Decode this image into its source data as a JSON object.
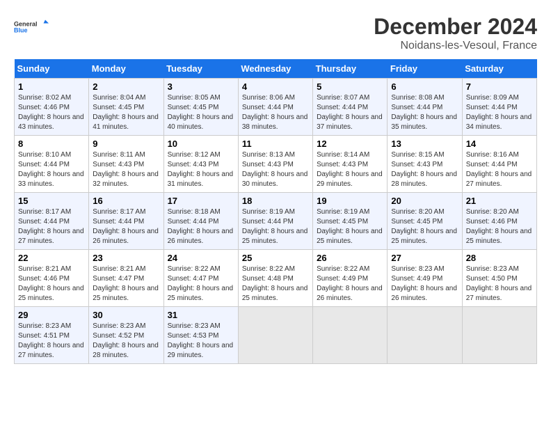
{
  "logo": {
    "text1": "General",
    "text2": "Blue"
  },
  "title": "December 2024",
  "subtitle": "Noidans-les-Vesoul, France",
  "days_header": [
    "Sunday",
    "Monday",
    "Tuesday",
    "Wednesday",
    "Thursday",
    "Friday",
    "Saturday"
  ],
  "weeks": [
    [
      {
        "day": "1",
        "sunrise": "Sunrise: 8:02 AM",
        "sunset": "Sunset: 4:46 PM",
        "daylight": "Daylight: 8 hours and 43 minutes."
      },
      {
        "day": "2",
        "sunrise": "Sunrise: 8:04 AM",
        "sunset": "Sunset: 4:45 PM",
        "daylight": "Daylight: 8 hours and 41 minutes."
      },
      {
        "day": "3",
        "sunrise": "Sunrise: 8:05 AM",
        "sunset": "Sunset: 4:45 PM",
        "daylight": "Daylight: 8 hours and 40 minutes."
      },
      {
        "day": "4",
        "sunrise": "Sunrise: 8:06 AM",
        "sunset": "Sunset: 4:44 PM",
        "daylight": "Daylight: 8 hours and 38 minutes."
      },
      {
        "day": "5",
        "sunrise": "Sunrise: 8:07 AM",
        "sunset": "Sunset: 4:44 PM",
        "daylight": "Daylight: 8 hours and 37 minutes."
      },
      {
        "day": "6",
        "sunrise": "Sunrise: 8:08 AM",
        "sunset": "Sunset: 4:44 PM",
        "daylight": "Daylight: 8 hours and 35 minutes."
      },
      {
        "day": "7",
        "sunrise": "Sunrise: 8:09 AM",
        "sunset": "Sunset: 4:44 PM",
        "daylight": "Daylight: 8 hours and 34 minutes."
      }
    ],
    [
      {
        "day": "8",
        "sunrise": "Sunrise: 8:10 AM",
        "sunset": "Sunset: 4:44 PM",
        "daylight": "Daylight: 8 hours and 33 minutes."
      },
      {
        "day": "9",
        "sunrise": "Sunrise: 8:11 AM",
        "sunset": "Sunset: 4:43 PM",
        "daylight": "Daylight: 8 hours and 32 minutes."
      },
      {
        "day": "10",
        "sunrise": "Sunrise: 8:12 AM",
        "sunset": "Sunset: 4:43 PM",
        "daylight": "Daylight: 8 hours and 31 minutes."
      },
      {
        "day": "11",
        "sunrise": "Sunrise: 8:13 AM",
        "sunset": "Sunset: 4:43 PM",
        "daylight": "Daylight: 8 hours and 30 minutes."
      },
      {
        "day": "12",
        "sunrise": "Sunrise: 8:14 AM",
        "sunset": "Sunset: 4:43 PM",
        "daylight": "Daylight: 8 hours and 29 minutes."
      },
      {
        "day": "13",
        "sunrise": "Sunrise: 8:15 AM",
        "sunset": "Sunset: 4:43 PM",
        "daylight": "Daylight: 8 hours and 28 minutes."
      },
      {
        "day": "14",
        "sunrise": "Sunrise: 8:16 AM",
        "sunset": "Sunset: 4:44 PM",
        "daylight": "Daylight: 8 hours and 27 minutes."
      }
    ],
    [
      {
        "day": "15",
        "sunrise": "Sunrise: 8:17 AM",
        "sunset": "Sunset: 4:44 PM",
        "daylight": "Daylight: 8 hours and 27 minutes."
      },
      {
        "day": "16",
        "sunrise": "Sunrise: 8:17 AM",
        "sunset": "Sunset: 4:44 PM",
        "daylight": "Daylight: 8 hours and 26 minutes."
      },
      {
        "day": "17",
        "sunrise": "Sunrise: 8:18 AM",
        "sunset": "Sunset: 4:44 PM",
        "daylight": "Daylight: 8 hours and 26 minutes."
      },
      {
        "day": "18",
        "sunrise": "Sunrise: 8:19 AM",
        "sunset": "Sunset: 4:44 PM",
        "daylight": "Daylight: 8 hours and 25 minutes."
      },
      {
        "day": "19",
        "sunrise": "Sunrise: 8:19 AM",
        "sunset": "Sunset: 4:45 PM",
        "daylight": "Daylight: 8 hours and 25 minutes."
      },
      {
        "day": "20",
        "sunrise": "Sunrise: 8:20 AM",
        "sunset": "Sunset: 4:45 PM",
        "daylight": "Daylight: 8 hours and 25 minutes."
      },
      {
        "day": "21",
        "sunrise": "Sunrise: 8:20 AM",
        "sunset": "Sunset: 4:46 PM",
        "daylight": "Daylight: 8 hours and 25 minutes."
      }
    ],
    [
      {
        "day": "22",
        "sunrise": "Sunrise: 8:21 AM",
        "sunset": "Sunset: 4:46 PM",
        "daylight": "Daylight: 8 hours and 25 minutes."
      },
      {
        "day": "23",
        "sunrise": "Sunrise: 8:21 AM",
        "sunset": "Sunset: 4:47 PM",
        "daylight": "Daylight: 8 hours and 25 minutes."
      },
      {
        "day": "24",
        "sunrise": "Sunrise: 8:22 AM",
        "sunset": "Sunset: 4:47 PM",
        "daylight": "Daylight: 8 hours and 25 minutes."
      },
      {
        "day": "25",
        "sunrise": "Sunrise: 8:22 AM",
        "sunset": "Sunset: 4:48 PM",
        "daylight": "Daylight: 8 hours and 25 minutes."
      },
      {
        "day": "26",
        "sunrise": "Sunrise: 8:22 AM",
        "sunset": "Sunset: 4:49 PM",
        "daylight": "Daylight: 8 hours and 26 minutes."
      },
      {
        "day": "27",
        "sunrise": "Sunrise: 8:23 AM",
        "sunset": "Sunset: 4:49 PM",
        "daylight": "Daylight: 8 hours and 26 minutes."
      },
      {
        "day": "28",
        "sunrise": "Sunrise: 8:23 AM",
        "sunset": "Sunset: 4:50 PM",
        "daylight": "Daylight: 8 hours and 27 minutes."
      }
    ],
    [
      {
        "day": "29",
        "sunrise": "Sunrise: 8:23 AM",
        "sunset": "Sunset: 4:51 PM",
        "daylight": "Daylight: 8 hours and 27 minutes."
      },
      {
        "day": "30",
        "sunrise": "Sunrise: 8:23 AM",
        "sunset": "Sunset: 4:52 PM",
        "daylight": "Daylight: 8 hours and 28 minutes."
      },
      {
        "day": "31",
        "sunrise": "Sunrise: 8:23 AM",
        "sunset": "Sunset: 4:53 PM",
        "daylight": "Daylight: 8 hours and 29 minutes."
      },
      null,
      null,
      null,
      null
    ]
  ]
}
